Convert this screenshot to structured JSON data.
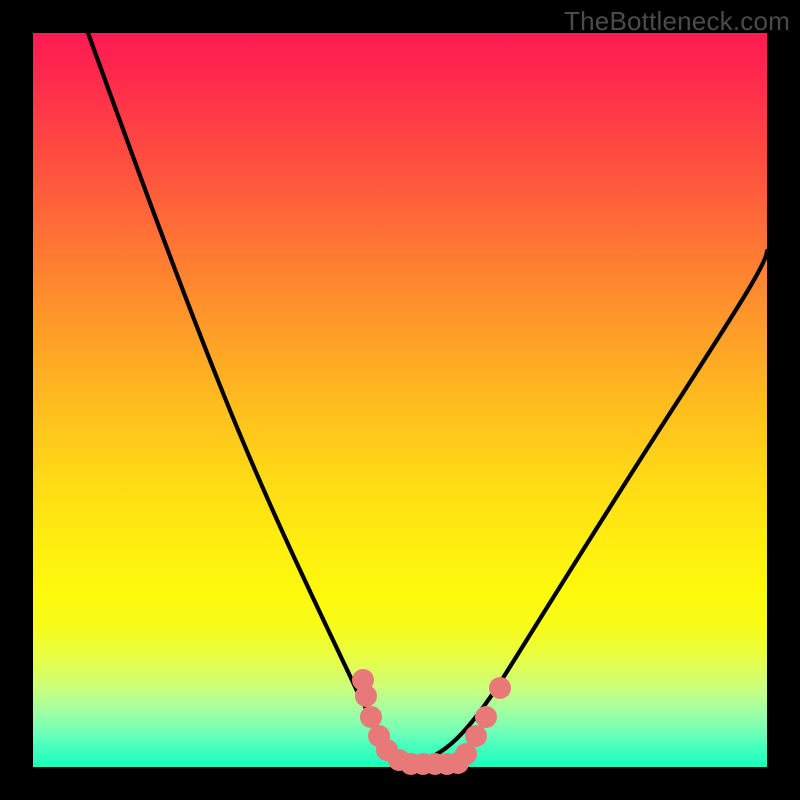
{
  "watermark": "TheBottleneck.com",
  "colors": {
    "frame": "#000000",
    "curve": "#000000",
    "dot": "#e77a78"
  },
  "chart_data": {
    "type": "line",
    "title": "",
    "xlabel": "",
    "ylabel": "",
    "xlim": [
      0,
      100
    ],
    "ylim": [
      0,
      100
    ],
    "series": [
      {
        "name": "left-curve",
        "x": [
          12,
          16,
          20,
          24,
          28,
          32,
          36,
          40,
          44,
          46,
          48,
          50,
          52
        ],
        "y": [
          100,
          88,
          76,
          64,
          53,
          42,
          32,
          22,
          13,
          9,
          5,
          3,
          1
        ]
      },
      {
        "name": "right-curve",
        "x": [
          52,
          56,
          60,
          64,
          70,
          78,
          86,
          94,
          100
        ],
        "y": [
          1,
          3,
          7,
          12,
          21,
          34,
          47,
          60,
          70
        ]
      }
    ],
    "markers": [
      {
        "x": 45.0,
        "y": 12.0
      },
      {
        "x": 45.4,
        "y": 10.0
      },
      {
        "x": 46.0,
        "y": 7.0
      },
      {
        "x": 47.0,
        "y": 4.5
      },
      {
        "x": 48.0,
        "y": 2.5
      },
      {
        "x": 49.5,
        "y": 1.2
      },
      {
        "x": 51.0,
        "y": 0.8
      },
      {
        "x": 52.5,
        "y": 0.8
      },
      {
        "x": 54.0,
        "y": 0.8
      },
      {
        "x": 55.5,
        "y": 0.8
      },
      {
        "x": 57.0,
        "y": 0.8
      },
      {
        "x": 58.0,
        "y": 2.0
      },
      {
        "x": 59.5,
        "y": 4.5
      },
      {
        "x": 61.0,
        "y": 7.0
      },
      {
        "x": 63.0,
        "y": 11.0
      }
    ]
  }
}
